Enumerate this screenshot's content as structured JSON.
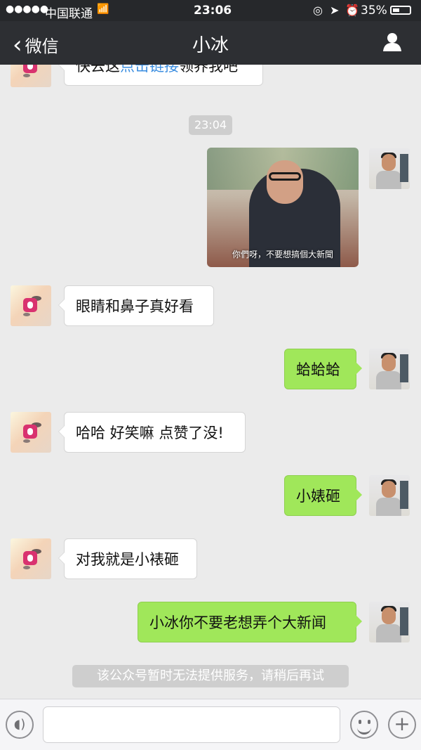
{
  "status": {
    "signal": "●●●●●",
    "carrier": "中国联通",
    "wifi": "📶",
    "time": "23:06",
    "battery": "35%"
  },
  "nav": {
    "back": "微信",
    "title": "小冰"
  },
  "chat": {
    "partial_message": {
      "before": "快去这",
      "link": "点击链接",
      "after": "领养我吧"
    },
    "timestamp": "23:04",
    "image_caption": "你們呀，不要想搞個大新聞",
    "messages": [
      "眼睛和鼻子真好看",
      "蛤蛤蛤",
      "哈哈 好笑嘛 点赞了没!",
      "小婊砸",
      "对我就是小裱砸",
      "小冰你不要老想弄个大新闻"
    ],
    "system_notice": "该公众号暂时无法提供服务，请稍后再试"
  },
  "input": {
    "placeholder": ""
  }
}
